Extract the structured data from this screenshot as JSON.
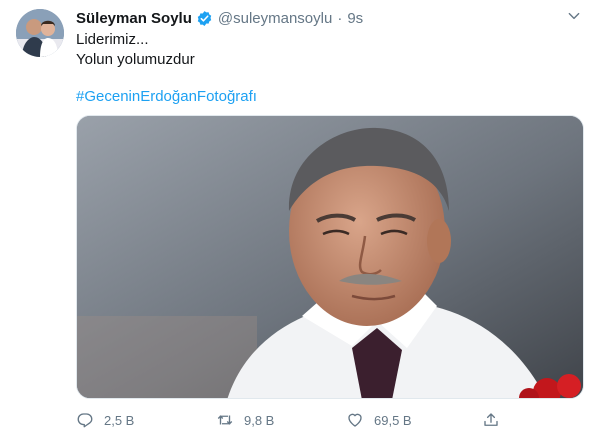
{
  "tweet": {
    "author_name": "Süleyman Soylu",
    "handle": "@suleymansoylu",
    "separator": "·",
    "time": "9s",
    "lines": [
      "Liderimiz...",
      "Yolun yolumuzdur"
    ],
    "hashtag": "#GeceninErdoğanFotoğrafı"
  },
  "icons": {
    "verified": "verified-badge-icon",
    "caret": "chevron-down-icon",
    "reply": "reply-icon",
    "retweet": "retweet-icon",
    "like": "like-icon",
    "share": "share-icon"
  },
  "actions": {
    "reply_count": "2,5 B",
    "retweet_count": "9,8 B",
    "like_count": "69,5 B"
  },
  "colors": {
    "link": "#1da1f2",
    "secondary_text": "#657786",
    "primary_text": "#14171a"
  }
}
